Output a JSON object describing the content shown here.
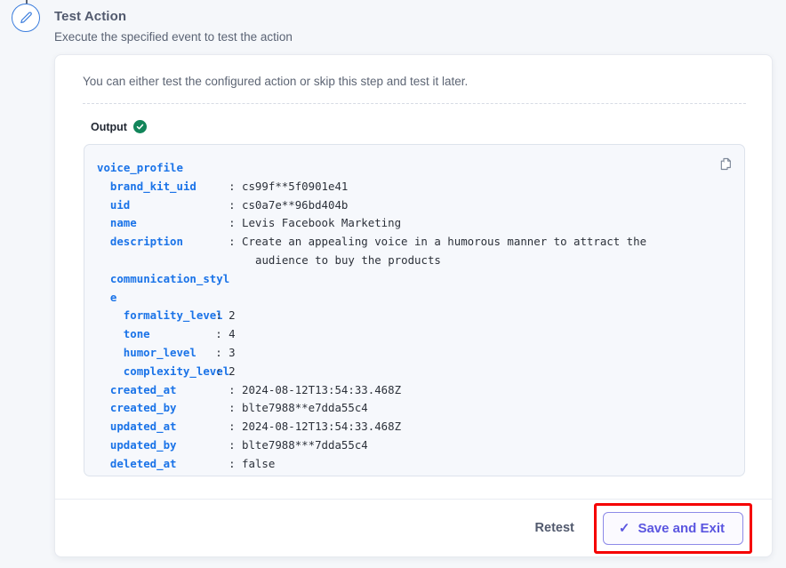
{
  "step": {
    "icon": "pencil-edit-icon",
    "title": "Test Action",
    "subtitle": "Execute the specified event to test the action"
  },
  "card": {
    "intro": "You can either test the configured action or skip this step and test it later.",
    "output_label": "Output",
    "status_icon": "green-check-circle-icon",
    "copy_icon": "copy-icon"
  },
  "output": {
    "lines": [
      {
        "indent": 0,
        "key": "voice_profile",
        "value": null
      },
      {
        "indent": 1,
        "key": "brand_kit_uid",
        "value": "cs99f**5f0901e41"
      },
      {
        "indent": 1,
        "key": "uid",
        "value": "cs0a7e**96bd404b"
      },
      {
        "indent": 1,
        "key": "name",
        "value": "Levis Facebook Marketing"
      },
      {
        "indent": 1,
        "key": "description",
        "value": "Create an appealing voice in a humorous manner to attract the"
      },
      {
        "indent": 1,
        "key": null,
        "value": "audience to buy the products",
        "continuation": true
      },
      {
        "indent": 1,
        "key": "communication_styl",
        "value": null
      },
      {
        "indent": 1,
        "key": "e",
        "value": null
      },
      {
        "indent": 2,
        "key": "formality_level",
        "value": "2"
      },
      {
        "indent": 2,
        "key": "tone",
        "value": "4"
      },
      {
        "indent": 2,
        "key": "humor_level",
        "value": "3"
      },
      {
        "indent": 2,
        "key": "complexity_level",
        "value": "2"
      },
      {
        "indent": 1,
        "key": "created_at",
        "value": "2024-08-12T13:54:33.468Z"
      },
      {
        "indent": 1,
        "key": "created_by",
        "value": "blte7988**e7dda55c4"
      },
      {
        "indent": 1,
        "key": "updated_at",
        "value": "2024-08-12T13:54:33.468Z"
      },
      {
        "indent": 1,
        "key": "updated_by",
        "value": "blte7988***7dda55c4"
      },
      {
        "indent": 1,
        "key": "deleted_at",
        "value": "false"
      }
    ]
  },
  "footer": {
    "retest_label": "Retest",
    "save_label": "Save and Exit",
    "save_icon": "check-mark-icon"
  },
  "colors": {
    "page_background": "#f5f7fa",
    "card_background": "#ffffff",
    "code_background": "#f6f8fc",
    "json_key": "#1a73e8",
    "json_value": "#2c313a",
    "accent_purple": "#5b56e0",
    "status_green": "#12855a",
    "highlight_red": "#f50000",
    "step_blue": "#3b7ddd"
  }
}
